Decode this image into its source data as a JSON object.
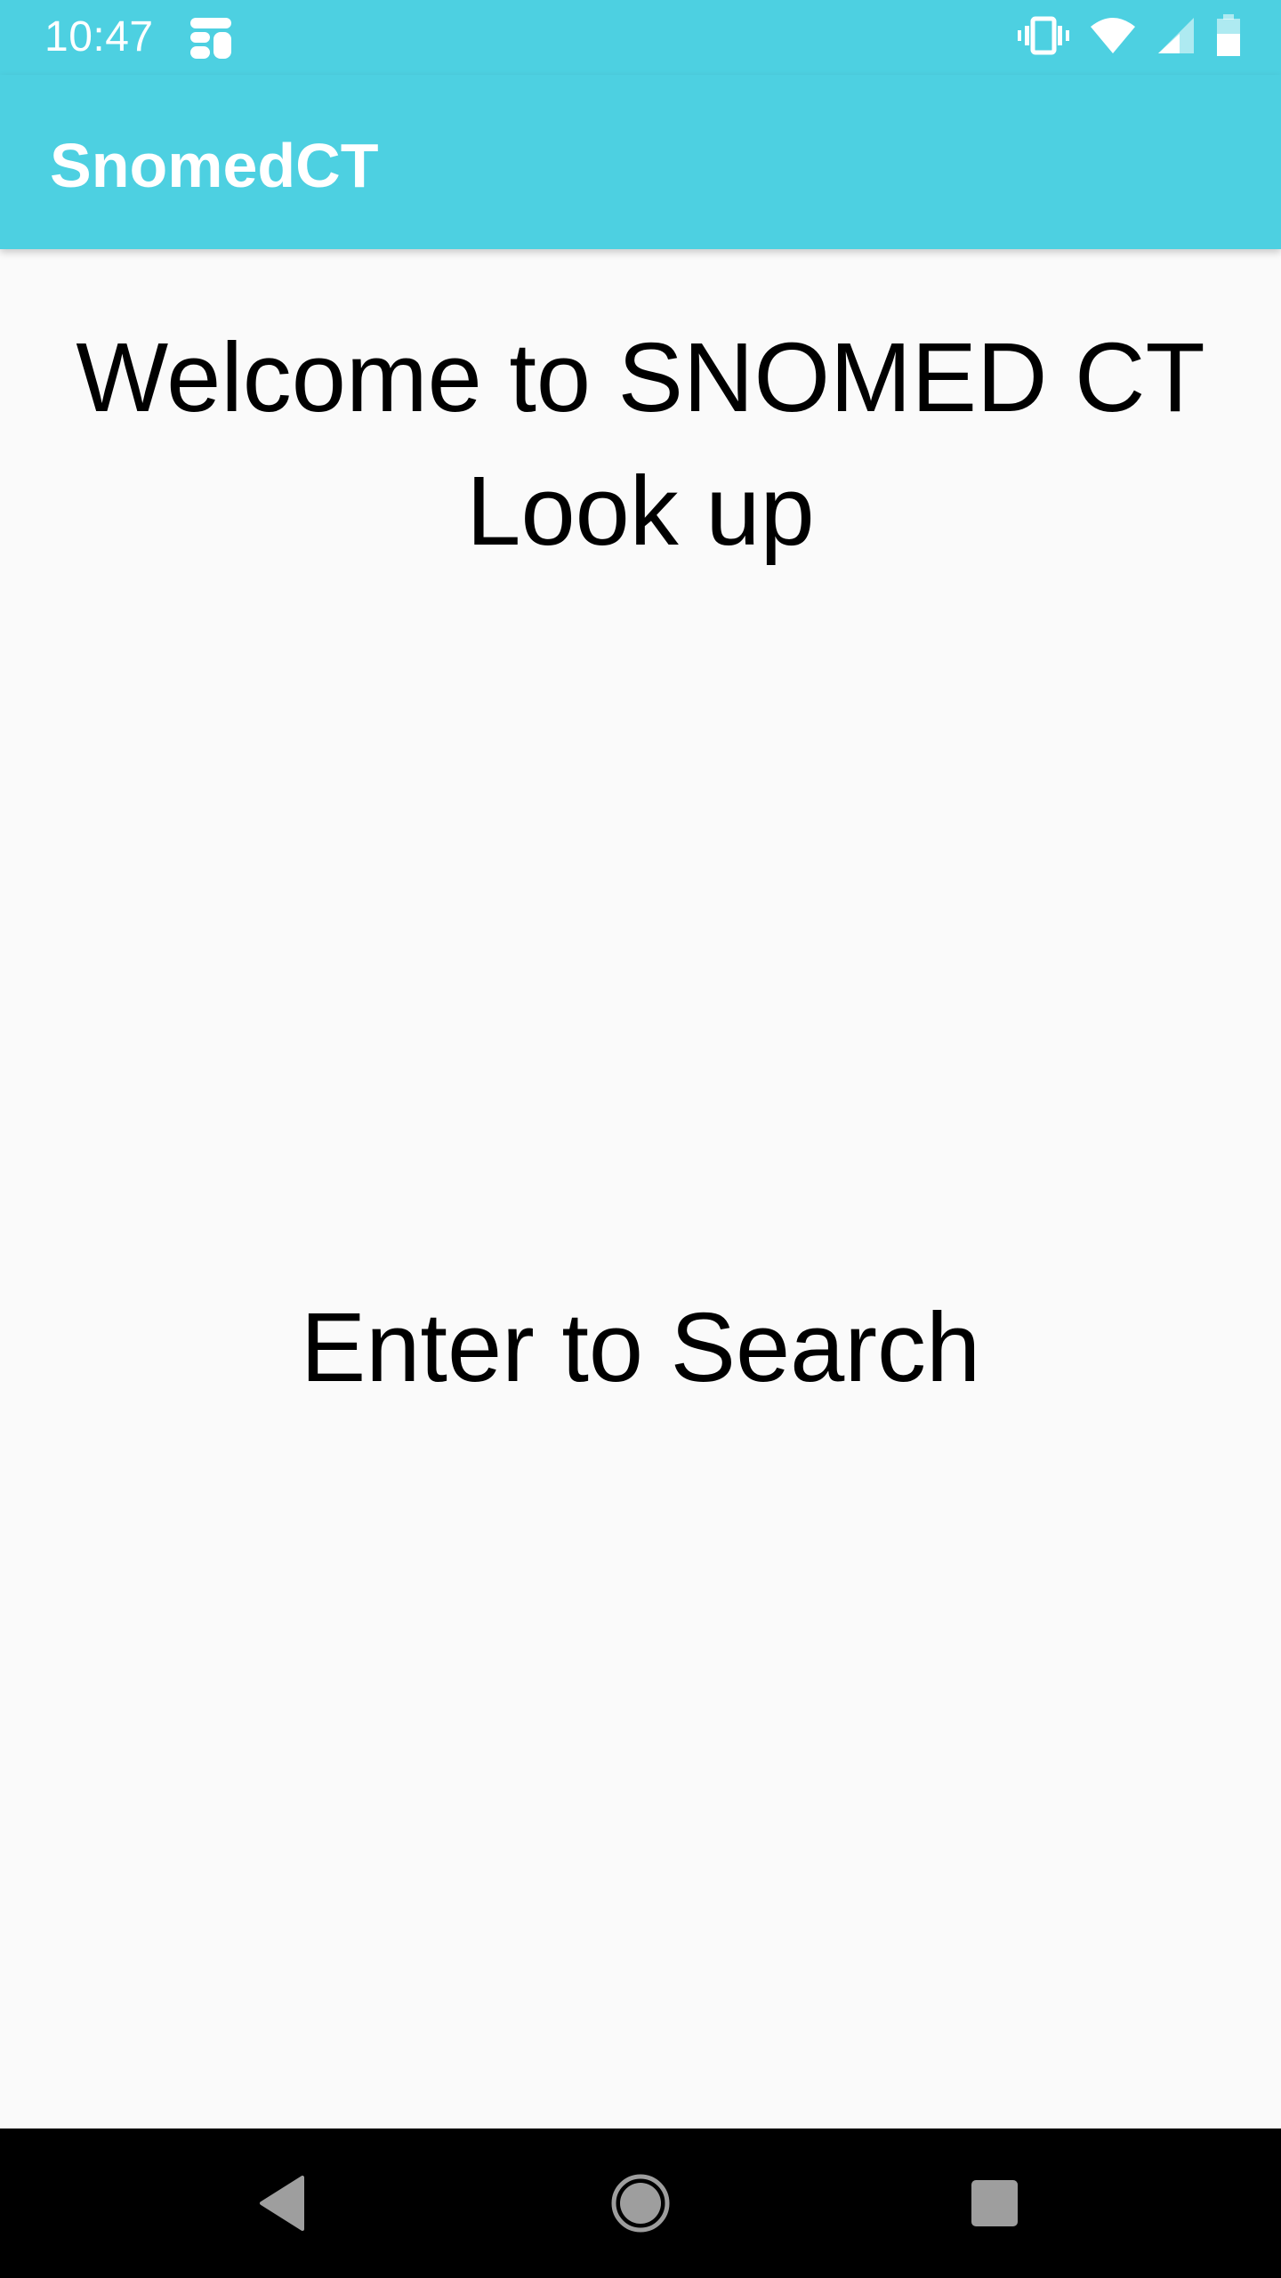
{
  "status_bar": {
    "time": "10:47",
    "background": "#4dd0e1",
    "icons": [
      "app-notification-icon",
      "vibrate-icon",
      "wifi-icon",
      "cell-signal-icon",
      "battery-icon"
    ]
  },
  "app_bar": {
    "title": "SnomedCT",
    "background": "#4dd0e1"
  },
  "main": {
    "welcome_line1": "Welcome to SNOMED CT",
    "welcome_line2": "Look up",
    "search_prompt": "Enter to Search"
  },
  "nav_bar": {
    "icons": [
      "back-icon",
      "home-icon",
      "recents-icon"
    ],
    "icon_color": "#9e9e9e"
  }
}
